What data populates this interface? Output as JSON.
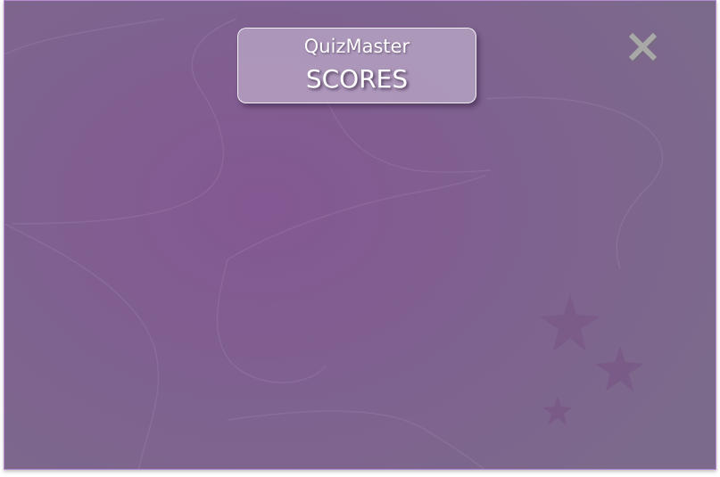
{
  "header": {
    "brand": "QuizMaster",
    "title": "SCORES"
  },
  "controls": {
    "close_icon": "close-icon"
  },
  "colors": {
    "background": "#845893",
    "card_fill": "#c8bad4",
    "close_icon": "#a8a8a8",
    "stars": "#7a5a88"
  }
}
